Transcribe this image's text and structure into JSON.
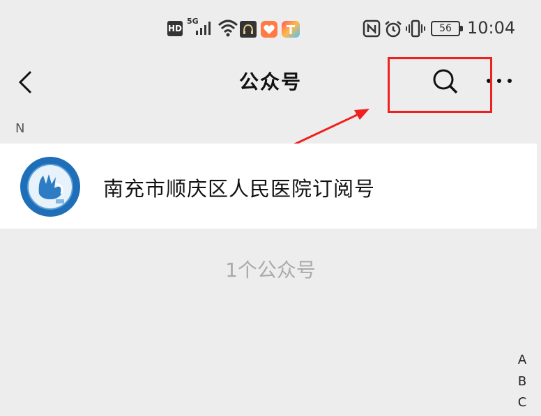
{
  "status_bar": {
    "hd": "HD",
    "network": "5G",
    "battery": "56",
    "time": "10:04",
    "icons": [
      "hd-icon",
      "signal-icon",
      "wifi-icon",
      "headphone-app-icon",
      "health-app-icon",
      "t-app-icon",
      "nfc-icon",
      "alarm-icon",
      "vibrate-icon",
      "battery-icon"
    ]
  },
  "nav": {
    "title": "公众号",
    "back_icon": "chevron-left-icon",
    "search_icon": "search-icon",
    "more_icon": "more-icon"
  },
  "section": {
    "letter": "N",
    "items": [
      {
        "name": "南充市顺庆区人民医院订阅号",
        "avatar": "hospital-logo-icon"
      }
    ]
  },
  "footer": {
    "count_text": "1个公众号"
  },
  "index_bar": {
    "letters": [
      "A",
      "B",
      "C"
    ]
  },
  "colors": {
    "annotation": "#ee2020",
    "background": "#ededed",
    "logo_blue": "#1e6fb8"
  }
}
